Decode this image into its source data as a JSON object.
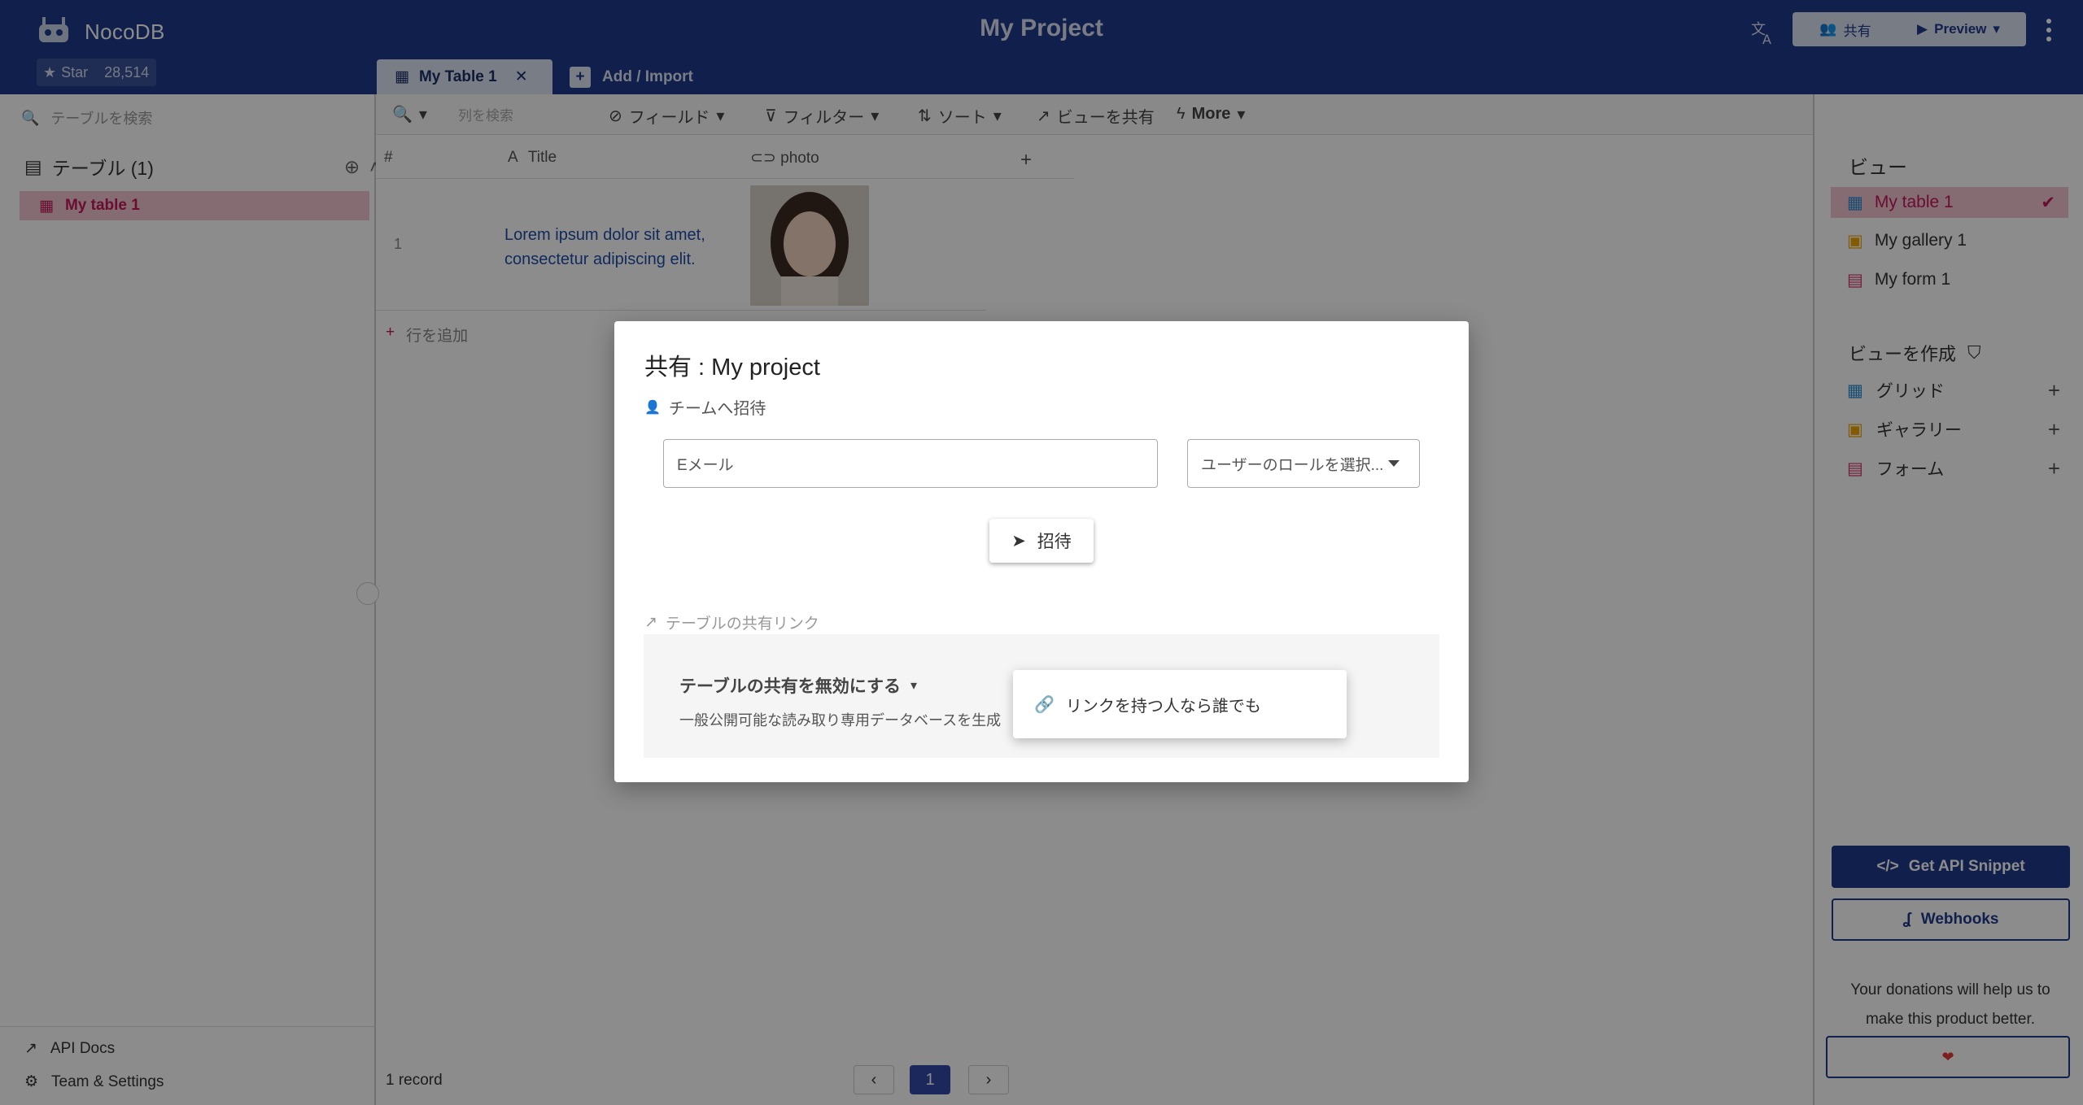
{
  "app": {
    "brand": "NocoDB",
    "star_label": "Star",
    "star_count": "28,514"
  },
  "header": {
    "project_title": "My Project",
    "share_label": "共有",
    "preview_label": "Preview"
  },
  "tabs": [
    {
      "label": "My Table 1"
    },
    {
      "label": "Add / Import"
    }
  ],
  "sidebar": {
    "search_placeholder": "テーブルを検索",
    "tables_heading": "テーブル (1)",
    "tables": [
      {
        "label": "My table 1"
      }
    ],
    "bottom": {
      "api_docs": "API Docs",
      "team_settings": "Team & Settings"
    }
  },
  "toolbar": {
    "search_placeholder": "列を検索",
    "fields": "フィールド",
    "filter": "フィルター",
    "sort": "ソート",
    "share_view": "ビューを共有",
    "more": "More"
  },
  "grid": {
    "columns": [
      "#",
      "Title",
      "photo"
    ],
    "rows": [
      {
        "index": "1",
        "title": "Lorem ipsum dolor sit amet, consectetur adipiscing elit."
      }
    ],
    "add_row": "行を追加",
    "record_count": "1 record",
    "current_page": "1"
  },
  "views_panel": {
    "heading": "ビュー",
    "views": [
      {
        "label": "My table 1",
        "color": "#2a8fd6"
      },
      {
        "label": "My gallery 1",
        "color": "#f0a500"
      },
      {
        "label": "My form 1",
        "color": "#d6336c"
      }
    ],
    "create_heading": "ビューを作成",
    "create_items": [
      {
        "label": "グリッド",
        "color": "#2a8fd6"
      },
      {
        "label": "ギャラリー",
        "color": "#f0a500"
      },
      {
        "label": "フォーム",
        "color": "#d6336c"
      }
    ],
    "api_snippet": "Get API Snippet",
    "webhooks": "Webhooks",
    "donation_text": "Your donations will help us to make this product better."
  },
  "modal": {
    "title": "共有 : My project",
    "invite_section": "チームへ招待",
    "email_placeholder": "Eメール",
    "role_placeholder": "ユーザーのロールを選択...",
    "invite_button": "招待",
    "share_link_section": "テーブルの共有リンク",
    "disable_share": "テーブルの共有を無効にする",
    "disable_desc": "一般公開可能な読み取り専用データベースを生成",
    "dropdown_option": "リンクを持つ人なら誰でも"
  },
  "colors": {
    "header": "#1f3a8a",
    "accent": "#c2185b"
  }
}
